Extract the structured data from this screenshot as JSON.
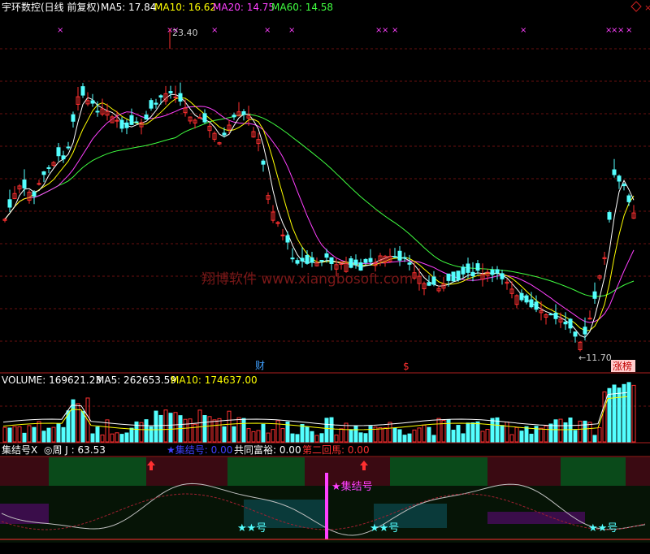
{
  "header": {
    "title": "宇环数控(日线 前复权)",
    "ma5_label": "MA5: 17.84",
    "ma10_label": "MA10: 16.62",
    "ma20_label": "MA20: 14.75",
    "ma60_label": "MA60: 14.58"
  },
  "main_panel": {
    "high_label": "23.40",
    "low_label": "11.70",
    "cai_marker": "财",
    "dollar_marker": "$",
    "zhangting_badge": "涨榜",
    "watermark": "翔博软件 www.xiangbosoft.com"
  },
  "volume_panel": {
    "volume_label": "VOLUME: 169621.23",
    "ma5_label": "MA5: 262653.59",
    "ma10_label": "MA10: 174637.00"
  },
  "indicator_panel": {
    "name": "集结号X",
    "week_j_label": "◎周 J : 63.53",
    "jijie_label": "★集结号: 0.00",
    "gongtong_label": "共同富裕: 0.00",
    "dierhuifeng_label": "第二回馬: 0.00",
    "jijie_annotation": "★集结号",
    "stars_annotation_1": "★★号",
    "stars_annotation_2": "★★号",
    "stars_annotation_3": "★★号"
  },
  "colors": {
    "up": "#ff3030",
    "down": "#54ffff",
    "ma5": "#ffffff",
    "ma10": "#ffff00",
    "ma20": "#ff40ff",
    "ma60": "#40ff40",
    "accent_pink": "#ff40ff"
  }
}
